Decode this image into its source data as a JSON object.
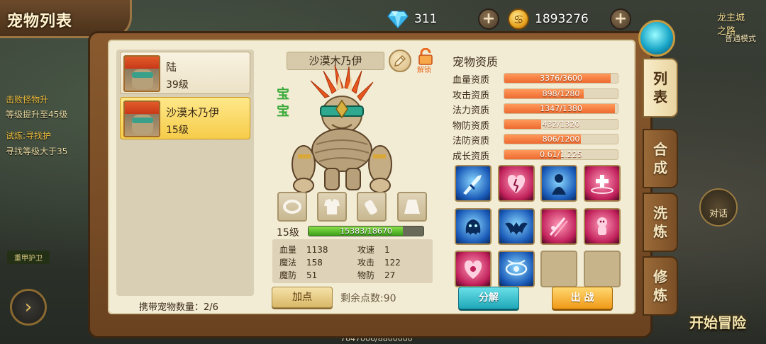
{
  "header": {
    "title": "宠物列表",
    "gems": "311",
    "gold": "1893276",
    "gold_symbol": "♋"
  },
  "background": {
    "quests": [
      "击败怪物升",
      "等级提升至45级",
      "试炼:寻找护",
      "寻找等级大于35"
    ],
    "guard_label": "重甲护卫",
    "mainland": "龙主城",
    "mainland_sub": "之路",
    "mode": "普通模式",
    "chat": "对话",
    "adventure": "开始冒险",
    "exp": "7647006/8800000"
  },
  "pet_list": {
    "pets": [
      {
        "name": "陆",
        "level": "39级",
        "selected": false
      },
      {
        "name": "沙漠木乃伊",
        "level": "15级",
        "selected": true
      }
    ],
    "carry_label": "携带宠物数量：",
    "carry_value": "2/6"
  },
  "pet_detail": {
    "name": "沙漠木乃伊",
    "unlock_label": "解锁",
    "tag": "宝宝",
    "level": "15级",
    "exp_text": "15383/18670",
    "exp_fraction": 0.824,
    "stats": [
      {
        "key": "血量",
        "value": "1138"
      },
      {
        "key": "攻速",
        "value": "1"
      },
      {
        "key": "魔法",
        "value": "158"
      },
      {
        "key": "攻击",
        "value": "122"
      },
      {
        "key": "魔防",
        "value": "51"
      },
      {
        "key": "物防",
        "value": "27"
      }
    ],
    "add_points_label": "加点",
    "remaining_label": "剩余点数:",
    "remaining_value": "90"
  },
  "aptitude": {
    "title": "宠物资质",
    "rows": [
      {
        "label": "血量资质",
        "text": "3376/3600",
        "fraction": 0.938
      },
      {
        "label": "攻击资质",
        "text": "898/1280",
        "fraction": 0.702
      },
      {
        "label": "法力资质",
        "text": "1347/1380",
        "fraction": 0.976
      },
      {
        "label": "物防资质",
        "text": "432/1320",
        "fraction": 0.327
      },
      {
        "label": "法防资质",
        "text": "806/1200",
        "fraction": 0.672
      },
      {
        "label": "成长资质",
        "text": "0.61/1.225",
        "fraction": 0.498
      }
    ]
  },
  "skills": [
    {
      "name": "sword-strike-skill-icon",
      "style": "blue"
    },
    {
      "name": "heart-break-skill-icon",
      "style": "red"
    },
    {
      "name": "shadow-figure-skill-icon",
      "style": "blue"
    },
    {
      "name": "heal-cross-skill-icon",
      "style": "red"
    },
    {
      "name": "spirit-blob-skill-icon",
      "style": "blue"
    },
    {
      "name": "bat-wing-skill-icon",
      "style": "blue"
    },
    {
      "name": "blood-slash-skill-icon",
      "style": "red"
    },
    {
      "name": "voodoo-doll-skill-icon",
      "style": "red"
    },
    {
      "name": "burst-heart-skill-icon",
      "style": "red"
    },
    {
      "name": "eye-vortex-skill-icon",
      "style": "blue"
    },
    {
      "name": "empty-skill-slot",
      "style": "empty"
    },
    {
      "name": "empty-skill-slot",
      "style": "empty"
    }
  ],
  "actions": {
    "decompose_label": "分解",
    "battle_label": "出 战"
  },
  "side_tabs": [
    {
      "label": "列表",
      "active": true
    },
    {
      "label": "合成",
      "active": false
    },
    {
      "label": "洗炼",
      "active": false
    },
    {
      "label": "修炼",
      "active": false
    }
  ],
  "colors": {
    "panel_bg": "#f3ecd4",
    "aptitude_fill": "#ee6a30",
    "exp_fill": "#3aa018",
    "decompose_btn": "#1ea8b8",
    "battle_btn": "#f09a18"
  }
}
